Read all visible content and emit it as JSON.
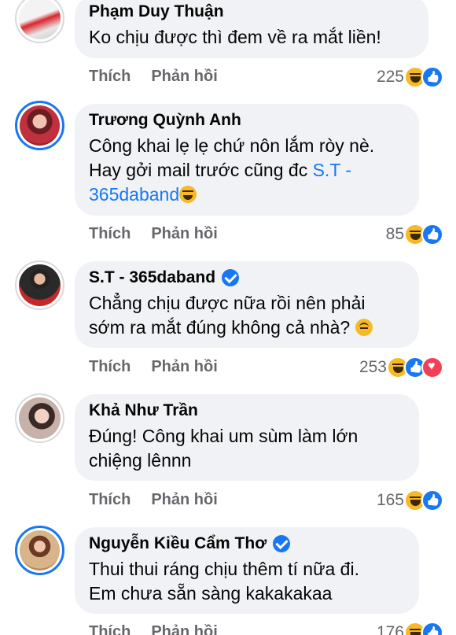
{
  "actions": {
    "like": "Thích",
    "reply": "Phản hồi"
  },
  "comments": [
    {
      "author": "Phạm Duy Thuận",
      "text": "Ko chịu được thì đem về ra mắt liền!",
      "reaction_count": "225",
      "reactions": [
        "haha",
        "like"
      ]
    },
    {
      "author": "Trương Quỳnh Anh",
      "text_line1": "Công khai lẹ lẹ chứ nôn lắm ròy nè.",
      "text_line2": "Hay gởi mail trước cũng đc ",
      "tag_part1": "S.T -",
      "tag_part2": "365daband",
      "reaction_count": "85",
      "reactions": [
        "haha",
        "like"
      ]
    },
    {
      "author": "S.T - 365daband",
      "verified": true,
      "text_line1": "Chẳng chịu được nữa rồi nên phải",
      "text_line2": "sớm ra mắt đúng không cả nhà? ",
      "reaction_count": "253",
      "reactions": [
        "haha",
        "like",
        "love"
      ]
    },
    {
      "author": "Khả Như Trần",
      "text_line1": "Đúng! Công khai um sùm làm lớn",
      "text_line2": "chiệng lênnn",
      "reaction_count": "165",
      "reactions": [
        "haha",
        "like"
      ]
    },
    {
      "author": "Nguyễn Kiều Cẩm Thơ",
      "verified": true,
      "text_line1": "Thui thui ráng chịu thêm tí nữa đi.",
      "text_line2": "Em chưa sẵn sàng kakakakaa",
      "reaction_count": "176",
      "reactions": [
        "haha",
        "like"
      ]
    }
  ],
  "colors": {
    "bubble": "#f0f2f5",
    "link": "#1877f2",
    "meta": "#65676b",
    "haha": "#f7b928",
    "like": "#1877f2",
    "love": "#f33e58"
  }
}
